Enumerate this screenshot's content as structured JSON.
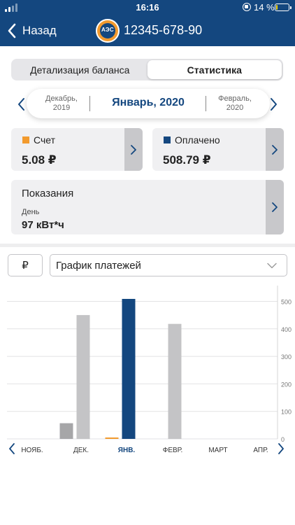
{
  "status_bar": {
    "time": "16:16",
    "battery_percent": "14 %",
    "battery_level": 0.14
  },
  "header": {
    "back_label": "Назад",
    "logo_text": "АЭС",
    "account_number": "12345-678-90",
    "background_color": "#14477f"
  },
  "tabs": [
    {
      "label": "Детализация баланса",
      "active": false
    },
    {
      "label": "Статистика",
      "active": true
    }
  ],
  "month_picker": {
    "previous": {
      "month": "Декабрь,",
      "year": "2019"
    },
    "current": "Январь, 2020",
    "next": {
      "month": "Февраль,",
      "year": "2020"
    }
  },
  "cards": {
    "bill": {
      "label": "Счет",
      "value": "5.08 ₽",
      "color": "#f29a2e"
    },
    "paid": {
      "label": "Оплачено",
      "value": "508.79 ₽",
      "color": "#14477f"
    },
    "readings": {
      "title": "Показания",
      "subtitle": "День",
      "value": "97 кВт*ч"
    }
  },
  "controls": {
    "currency": "₽",
    "chart_select": "График платежей"
  },
  "chart_data": {
    "type": "bar",
    "categories": [
      "НОЯБ.",
      "ДЕК.",
      "ЯНВ.",
      "ФЕВР.",
      "МАРТ",
      "АПР."
    ],
    "selected_category": "ЯНВ.",
    "series": [
      {
        "values": [
          0,
          57,
          5.08,
          0,
          0,
          0
        ],
        "color": "#f29a2e",
        "prior_color": "#a6a6a8"
      },
      {
        "values": [
          0,
          450,
          508.79,
          418,
          0,
          0
        ],
        "color": "#14477f",
        "prior_color": "#c4c4c6"
      }
    ],
    "y_ticks": [
      "0",
      "100",
      "200",
      "300",
      "400",
      "500"
    ],
    "ylim": [
      0,
      508.79
    ],
    "grid": true,
    "y_axis_position": "right"
  }
}
